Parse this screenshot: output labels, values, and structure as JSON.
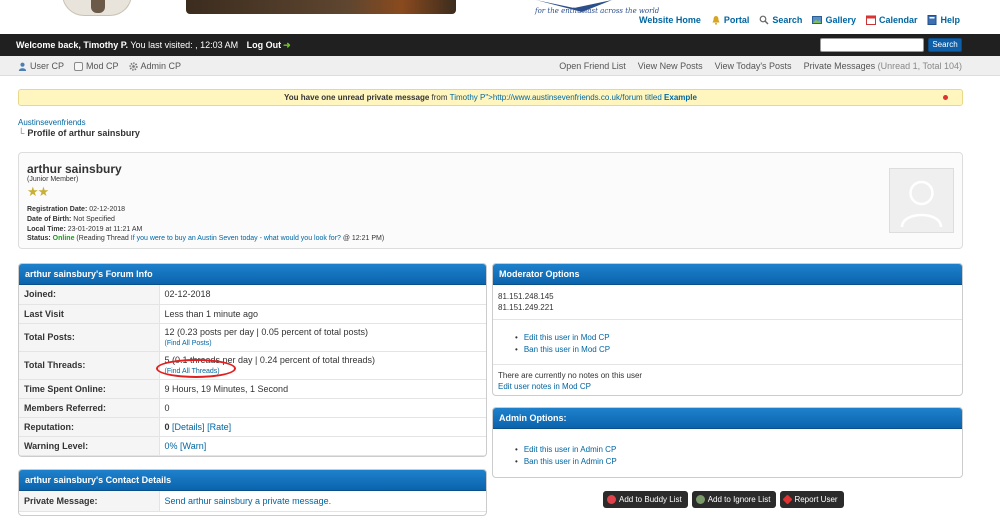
{
  "header": {
    "tagline": "for the enthusiast across the world",
    "links": [
      {
        "label": "Website Home",
        "icon": "home-icon"
      },
      {
        "label": "Portal",
        "icon": "bell-icon"
      },
      {
        "label": "Search",
        "icon": "search-icon"
      },
      {
        "label": "Gallery",
        "icon": "gallery-icon"
      },
      {
        "label": "Calendar",
        "icon": "calendar-icon"
      },
      {
        "label": "Help",
        "icon": "help-book-icon"
      }
    ]
  },
  "welcome": {
    "greeting": "Welcome back, Timothy P.",
    "visited": " You last visited: , 12:03 AM",
    "logout": "Log Out",
    "search_button": "Search",
    "search_value": ""
  },
  "panel": {
    "left": [
      {
        "label": "User CP",
        "icon": "user-icon"
      },
      {
        "label": "Mod CP",
        "icon": "document-icon"
      },
      {
        "label": "Admin CP",
        "icon": "gear-icon"
      }
    ],
    "right": {
      "friends": "Open Friend List",
      "new_posts": "View New Posts",
      "todays_posts": "View Today's Posts",
      "pm_label": "Private Messages",
      "pm_counts": "(Unread 1, Total 104)"
    }
  },
  "pm_alert": {
    "lead": "You have one unread private message",
    "from": " from ",
    "sender": "Timothy P\">http://www.austinsevenfriends.co.uk/forum titled ",
    "title": "Example"
  },
  "breadcrumb": {
    "root": "Austinsevenfriends",
    "current": "Profile of arthur sainsbury"
  },
  "profile": {
    "name": "arthur sainsbury",
    "usertitle": "(Junior Member)",
    "stars": "★★",
    "registration_label": "Registration Date:",
    "registration": " 02-12-2018",
    "dob_label": "Date of Birth:",
    "dob": " Not Specified",
    "local_time_label": "Local Time:",
    "local_time": " 23-01-2019 at 11:21 AM",
    "status_label": "Status:",
    "status": " Online",
    "status_reading": " (Reading Thread ",
    "status_thread": "If you were to buy an Austin Seven today - what would you look for?",
    "status_time": " @ 12:21 PM)"
  },
  "forum_info": {
    "heading": "arthur sainsbury's Forum Info",
    "joined_label": "Joined:",
    "joined": "02-12-2018",
    "last_visit_label": "Last Visit",
    "last_visit": "Less than 1 minute ago",
    "posts_label": "Total Posts:",
    "posts": "12 (0.23 posts per day | 0.05 percent of total posts)",
    "find_posts": "(Find All Posts)",
    "threads_label": "Total Threads:",
    "threads": "5 (0.1 threads per day | 0.24 percent of total threads)",
    "find_threads": "(Find All Threads)",
    "online_label": "Time Spent Online:",
    "online": "9 Hours, 19 Minutes, 1 Second",
    "referred_label": "Members Referred:",
    "referred": "0",
    "reputation_label": "Reputation:",
    "reputation": "0",
    "rep_details": "[Details]",
    "rep_rate": "[Rate]",
    "warning_label": "Warning Level:",
    "warning": "0%",
    "warn": "[Warn]"
  },
  "contact": {
    "heading": "arthur sainsbury's Contact Details",
    "pm_label": "Private Message:",
    "pm_link": "Send arthur sainsbury a private message."
  },
  "moderator": {
    "heading": "Moderator Options",
    "ip1": "81.151.248.145",
    "ip2": "81.151.249.221",
    "edit": "Edit this user in Mod CP",
    "ban": "Ban this user in Mod CP",
    "notes": "There are currently no notes on this user",
    "edit_notes": "Edit user notes in Mod CP"
  },
  "admin": {
    "heading": "Admin Options:",
    "edit": "Edit this user in Admin CP",
    "ban": "Ban this user in Admin CP"
  },
  "actions": {
    "buddy": "Add to Buddy List",
    "ignore": "Add to Ignore List",
    "report": "Report User"
  },
  "colors": {
    "accent": "#0b64ad",
    "link": "#0066a2",
    "online": "#15a018",
    "alert_bg": "#fff6bf"
  }
}
